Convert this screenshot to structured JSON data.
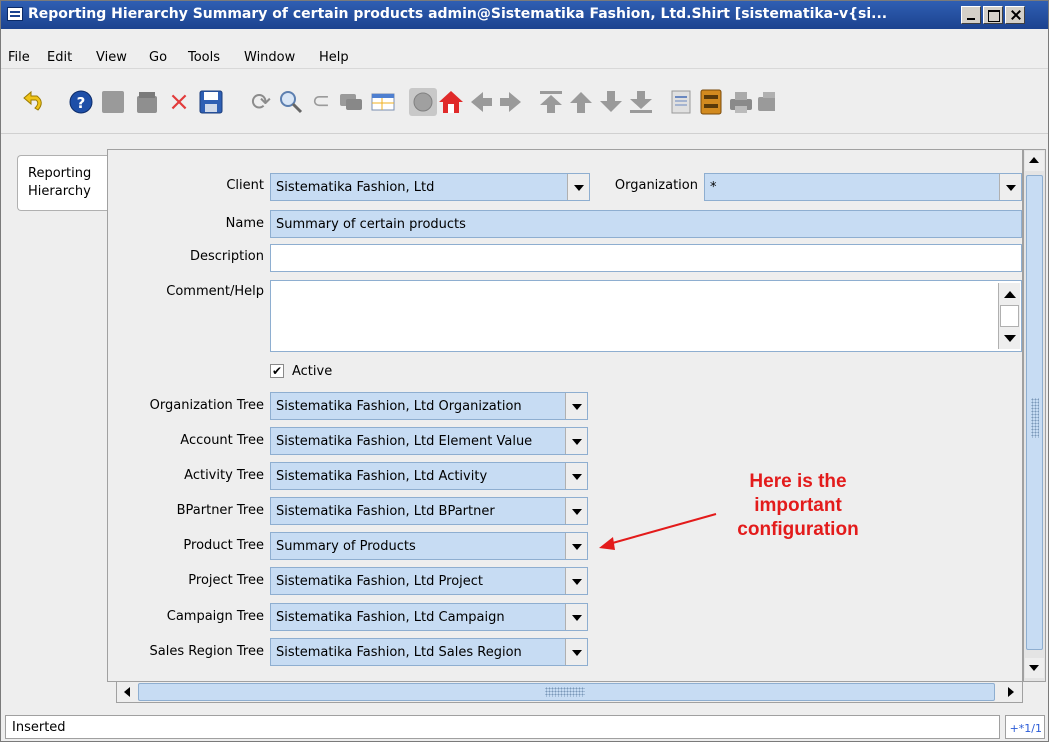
{
  "window": {
    "title": "Reporting Hierarchy  Summary of certain products  admin@Sistematika Fashion, Ltd.Shirt [sistematika-v{si..."
  },
  "menu": {
    "items": [
      {
        "label": "File"
      },
      {
        "label": "Edit"
      },
      {
        "label": "View"
      },
      {
        "label": "Go"
      },
      {
        "label": "Tools"
      },
      {
        "label": "Window"
      },
      {
        "label": "Help"
      }
    ]
  },
  "toolbar": {
    "icons": [
      "undo-icon",
      "help-icon",
      "new-record-icon",
      "copy-icon",
      "delete-icon",
      "save-icon",
      "refresh-icon",
      "find-icon",
      "attachment-icon",
      "chat-icon",
      "grid-toggle-icon",
      "history-icon",
      "home-icon",
      "previous-record-icon",
      "next-record-icon",
      "first-record-icon",
      "parent-record-icon",
      "detail-record-icon",
      "last-record-icon",
      "report-icon",
      "archive-icon",
      "print-icon",
      "product-info-icon"
    ]
  },
  "tabs": [
    {
      "label": "Reporting Hierarchy"
    }
  ],
  "form": {
    "client": {
      "label": "Client",
      "value": "Sistematika Fashion, Ltd"
    },
    "organization": {
      "label": "Organization",
      "value": "*"
    },
    "name": {
      "label": "Name",
      "value": "Summary of certain products"
    },
    "description": {
      "label": "Description",
      "value": ""
    },
    "comment_help": {
      "label": "Comment/Help",
      "value": ""
    },
    "active": {
      "label": "Active",
      "checked": true,
      "mark": "✔"
    },
    "trees": [
      {
        "label": "Organization Tree",
        "value": "Sistematika Fashion, Ltd Organization"
      },
      {
        "label": "Account Tree",
        "value": "Sistematika Fashion, Ltd Element Value"
      },
      {
        "label": "Activity Tree",
        "value": "Sistematika Fashion, Ltd Activity"
      },
      {
        "label": "BPartner Tree",
        "value": "Sistematika Fashion, Ltd BPartner"
      },
      {
        "label": "Product Tree",
        "value": "Summary of Products"
      },
      {
        "label": "Project Tree",
        "value": "Sistematika Fashion, Ltd Project"
      },
      {
        "label": "Campaign Tree",
        "value": "Sistematika Fashion, Ltd Campaign"
      },
      {
        "label": "Sales Region Tree",
        "value": "Sistematika Fashion, Ltd Sales Region"
      }
    ]
  },
  "annotation": {
    "lines": [
      "Here is the",
      "important",
      "configuration"
    ],
    "color": "#e31b1b"
  },
  "status": {
    "text": "Inserted",
    "record": "+*1/1"
  },
  "colors": {
    "titlebar": "#1c438f",
    "field_bg": "#c7dcf3",
    "panel_bg": "#eeeeee"
  }
}
